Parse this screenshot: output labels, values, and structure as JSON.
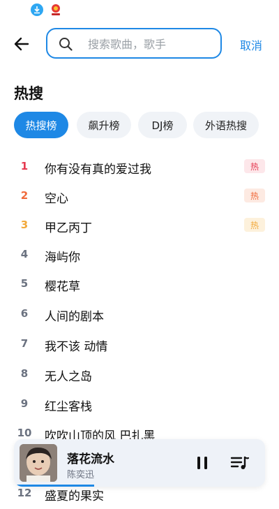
{
  "search": {
    "placeholder": "搜索歌曲，歌手",
    "value": "",
    "cancel_label": "取消"
  },
  "section": {
    "title": "热搜"
  },
  "tabs": [
    {
      "label": "热搜榜",
      "active": true
    },
    {
      "label": "飙升榜",
      "active": false
    },
    {
      "label": "DJ榜",
      "active": false
    },
    {
      "label": "外语热搜",
      "active": false
    }
  ],
  "hot_list": [
    {
      "rank": "1",
      "title": "你有没有真的爱过我",
      "badge": "热",
      "rank_color": "#e53950"
    },
    {
      "rank": "2",
      "title": "空心",
      "badge": "热",
      "rank_color": "#f06a3b"
    },
    {
      "rank": "3",
      "title": "甲乙丙丁",
      "badge": "热",
      "rank_color": "#f2a93b"
    },
    {
      "rank": "4",
      "title": "海屿你"
    },
    {
      "rank": "5",
      "title": "樱花草"
    },
    {
      "rank": "6",
      "title": "人间的剧本"
    },
    {
      "rank": "7",
      "title": "我不该 动情"
    },
    {
      "rank": "8",
      "title": "无人之岛"
    },
    {
      "rank": "9",
      "title": "红尘客栈"
    },
    {
      "rank": "10",
      "title": "吹吹山顶的风 巴扎黑"
    },
    {
      "rank": "12",
      "title": "盛夏的果实"
    }
  ],
  "badge_colors": {
    "1": {
      "bg": "#fde7ea",
      "fg": "#e53950"
    },
    "2": {
      "bg": "#fdeae2",
      "fg": "#f06a3b"
    },
    "3": {
      "bg": "#fdf1dc",
      "fg": "#f2a93b"
    }
  },
  "player": {
    "title": "落花流水",
    "artist": "陈奕迅",
    "progress": 0.32,
    "icons": {
      "play_state": "pause-icon",
      "queue": "playlist-icon"
    }
  },
  "colors": {
    "accent": "#1e88e5",
    "tab_bg": "#f0f3f7"
  }
}
